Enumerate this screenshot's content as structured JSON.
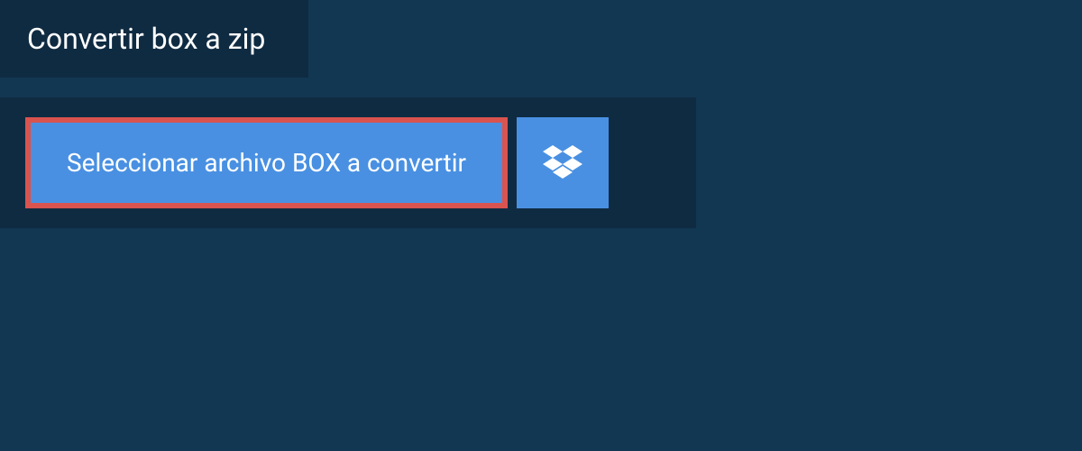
{
  "header": {
    "title": "Convertir box a zip"
  },
  "actions": {
    "selectFileLabel": "Seleccionar archivo BOX a convertir"
  }
}
